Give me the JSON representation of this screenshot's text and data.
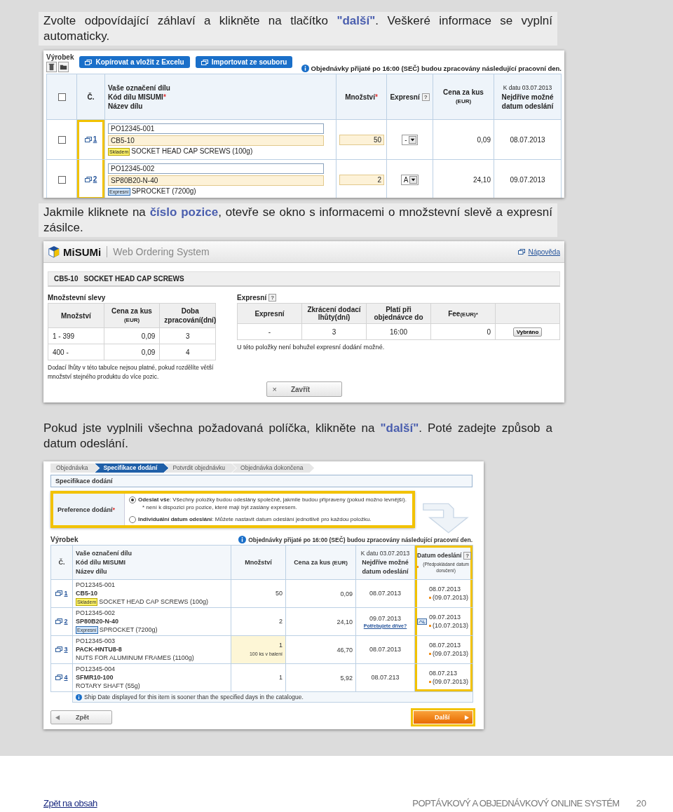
{
  "intro": "Zvolte odpovídající záhlaví a klikněte na tlačítko **\"další\"**. Veškeré informace se vyplní automaticky.",
  "order_form": {
    "section_label": "Výrobek",
    "actions": [
      "Kopírovat a vložit z Excelu",
      "Importovat ze souboru"
    ],
    "notice": "Objednávky přijaté po 16:00 (SEČ) budou zpracovány následující pracovní den.",
    "header": {
      "select_all_checked": false,
      "no": "Č.",
      "part": [
        {
          "text": "Vaše označení dílu"
        },
        {
          "text": "Kód dílu MISUMI",
          "mark": "*"
        },
        {
          "text": "Název dílu"
        }
      ],
      "qty": {
        "text": "Množství",
        "mark": "*"
      },
      "express": {
        "text": "Expresní",
        "help": "?"
      },
      "price": {
        "text": "Cena za kus",
        "sub": "(EUR)"
      },
      "date": {
        "note": "K datu 03.07.2013",
        "lines": [
          "Nejdříve možné",
          "datum odeslání"
        ]
      }
    },
    "rows": [
      {
        "checked": false,
        "no": "1",
        "ref": "PO12345-001",
        "code": "CB5-10",
        "tag": {
          "kind": "stock",
          "text": "Skladem"
        },
        "name": "SOCKET HEAD CAP SCREWS (100g)",
        "qty": "50",
        "express": "-",
        "price": "0,09",
        "date": "08.07.2013"
      },
      {
        "checked": false,
        "no": "2",
        "ref": "PO12345-002",
        "code": "SP80B20-N-40",
        "tag": {
          "kind": "express",
          "text": "Expresní"
        },
        "name": "SPROCKET (7200g)",
        "qty": "2",
        "express": "A",
        "price": "24,10",
        "date": "09.07.2013"
      }
    ]
  },
  "caption_2": "Jakmile kliknete na **číslo pozice**, otevře se okno s informacemi o množstevní slevě a expresní zásilce.",
  "detail_window": {
    "logo": "MiSUMi",
    "app_title": "Web Ordering System",
    "help_link": "Nápověda",
    "product_code": "CB5-10",
    "product_name": "SOCKET HEAD CAP SCREWS",
    "discounts": {
      "title": "Množstevní slevy",
      "columns": [
        {
          "text": "Množství"
        },
        {
          "text": "Cena za kus",
          "sub": "(EUR)"
        },
        {
          "text": "Doba zpracování(dní)"
        }
      ],
      "rows": [
        [
          "1 - 399",
          "0,09",
          "3"
        ],
        [
          "400 -",
          "0,09",
          "4"
        ]
      ],
      "note": "Dodací lhůty v této tabulce nejsou platné, pokud rozdělíte větší množství stejného produktu do více pozic."
    },
    "express": {
      "title": "Expresní",
      "help": "?",
      "columns": [
        {
          "text": "Expresní"
        },
        {
          "text": "Zkrácení dodací lhůty(dní)"
        },
        {
          "text": "Platí při objednávce do"
        },
        {
          "text": "Fee",
          "sub": "(EUR)*"
        }
      ],
      "rows": [
        {
          "cells": [
            "-",
            "3",
            "16:00",
            "0"
          ],
          "button": "Vybráno"
        }
      ],
      "note": "U této položky není bohužel expresní dodání možné."
    },
    "close_button": {
      "symbol": "×",
      "label": "Zavřít"
    }
  },
  "caption_3": "Pokud jste vyplnili všechna požadovaná políčka, klikněte na **\"další\"**. Poté zadejte způsob a datum odeslání.",
  "delivery_form": {
    "steps": [
      {
        "label": "Objednávka",
        "selected": false
      },
      {
        "label": "Specifikace dodání",
        "selected": true
      },
      {
        "label": "Potvrdit objednávku",
        "selected": false
      },
      {
        "label": "Objednávka dokončena",
        "selected": false
      }
    ],
    "section_title": "Specifikace dodání",
    "preference": {
      "label": "Preference dodání",
      "mark": "*",
      "options": [
        {
          "selected": true,
          "text": "**Odeslat vše**: Všechny položky budou odeslány společně, jakmile budou připraveny (pokud možno levnější).",
          "note": "* není k dispozici pro pozice, které mají být zaslány expresem."
        },
        {
          "selected": false,
          "text": "**Individuální datum odeslání**: Můžete nastavit datum odeslání jednotlivě pro každou položku."
        }
      ]
    },
    "section_label": "Výrobek",
    "notice": "Objednávky přijaté po 16:00 (SEČ) budou zpracovány následující pracovní den.",
    "header": {
      "no": "Č.",
      "part": [
        "Vaše označení dílu",
        "Kód dílu MISUMI",
        "Název dílu"
      ],
      "qty": "Množství",
      "price": {
        "text": "Cena za kus",
        "sub": "(EUR)"
      },
      "date": {
        "note": "K datu 03.07.2013",
        "lines": [
          "Nejdříve možné",
          "datum odeslání"
        ]
      },
      "ship": {
        "text": "Datum odeslání",
        "help": "?",
        "sub": "(Předpokládané datum doručení)"
      }
    },
    "rows": [
      {
        "no": "1",
        "ref": "PO12345-001",
        "code": "CB5-10",
        "tag": {
          "kind": "stock",
          "text": "Skladem"
        },
        "name": "SOCKET HEAD CAP SCREWS (100g)",
        "qty": "50",
        "price": "0,09",
        "date": "08.07.2013",
        "express_flag": false,
        "ship_date": "08.07.2013",
        "delivery_date": "(09.07.2013)"
      },
      {
        "no": "2",
        "ref": "PO12345-002",
        "code": "SP80B20-N-40",
        "tag": {
          "kind": "express",
          "text": "Expresní"
        },
        "name": "SPROCKET (7200g)",
        "qty": "2",
        "price": "24,10",
        "date": "09.07.2013",
        "date_link": "Potřebujete dříve?",
        "express_flag": true,
        "ship_date": "09.07.2013",
        "delivery_date": "(10.07.2013)"
      },
      {
        "no": "3",
        "ref": "PO12345-003",
        "code": "PACK-HNTU8-8",
        "name": "NUTS FOR ALUMINUM FRAMES (1100g)",
        "qty": "1",
        "qty_note": "100 ks v balení",
        "price": "46,70",
        "date": "08.07.2013",
        "express_flag": false,
        "ship_date": "08.07.2013",
        "delivery_date": "(09.07.2013)"
      },
      {
        "no": "4",
        "ref": "PO12345-004",
        "code": "SFMR10-100",
        "name": "ROTARY SHAFT (55g)",
        "qty": "1",
        "price": "5,92",
        "date": "08.07.213",
        "express_flag": false,
        "ship_date": "08.07.213",
        "delivery_date": "(09.07.2013)"
      }
    ],
    "info": "Ship Date displayed for this item is sooner than the specified days in the catalogue.",
    "back_button": "Zpět",
    "next_button": "Další"
  },
  "footer": {
    "link": "Zpět na obsah",
    "title": "POPTÁVKOVÝ A OBJEDNÁVKOVÝ ONLINE SYSTÉM",
    "page": "20"
  }
}
